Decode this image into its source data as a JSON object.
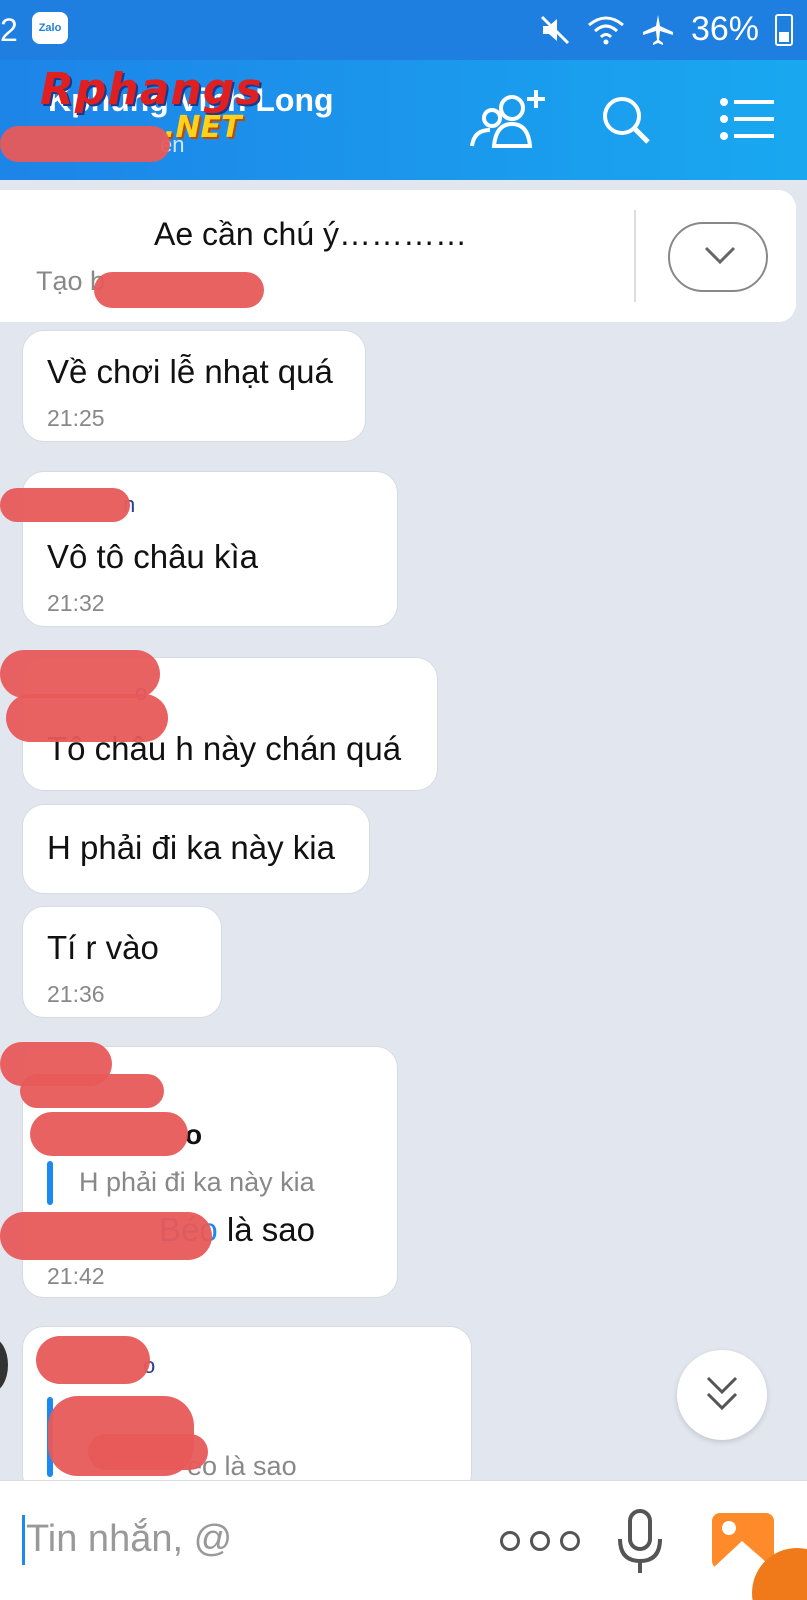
{
  "status_bar": {
    "left_number": "2",
    "app_badge": "Zalo",
    "battery": "36%"
  },
  "header": {
    "title": "Kphung Vinh Long",
    "subtitle": "en",
    "watermark_text": "Rphangs",
    "watermark_suffix": ".NET",
    "icons": [
      "add-member-icon",
      "search-icon",
      "menu-list-icon"
    ],
    "color": "#1d84e8"
  },
  "pinned": {
    "text": "Ae cần chú ý…………",
    "by_label": "Tạo b"
  },
  "messages": [
    {
      "sender": "",
      "text": "Về chơi lễ nhạt quá",
      "time": "21:25"
    },
    {
      "sender": "n",
      "text": "Vô tô châu kìa",
      "time": "21:32"
    },
    {
      "sender": "o",
      "text": "Tô châu h này chán quá",
      "time": ""
    },
    {
      "sender": "",
      "text": "H phải đi ka này kia",
      "time": ""
    },
    {
      "sender": "",
      "text": "Tí r vào",
      "time": "21:36"
    },
    {
      "sender": "o",
      "quote": "H phải đi ka này kia",
      "mention": "Béo",
      "text": " là sao",
      "time": "21:42"
    },
    {
      "sender": "o",
      "quote": "eo là sao",
      "text": "",
      "time": ""
    }
  ],
  "input": {
    "placeholder": "Tin nhắn, @"
  }
}
